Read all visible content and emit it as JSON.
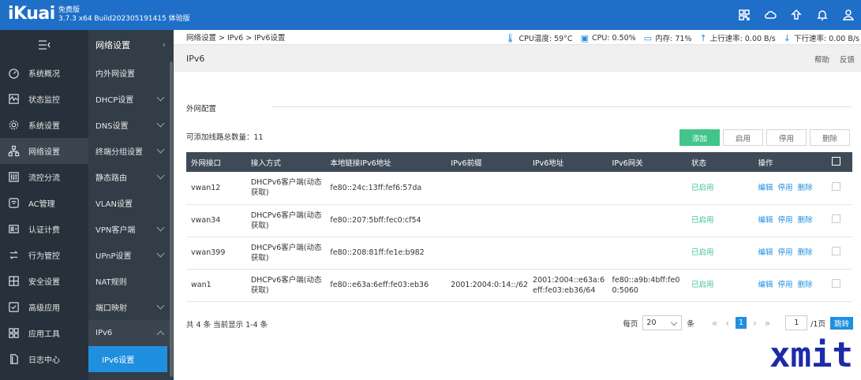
{
  "topbar": {
    "logo": "iKuai",
    "edition": "免费版",
    "version": "3.7.3 x64 Build202305191415 体验版",
    "icons": [
      "grid-icon",
      "cloud-icon",
      "upgrade-icon",
      "bell-icon",
      "user-icon"
    ]
  },
  "sidebar": {
    "items": [
      {
        "label": "系统概况",
        "icon": "dashboard-icon"
      },
      {
        "label": "状态监控",
        "icon": "monitor-icon"
      },
      {
        "label": "系统设置",
        "icon": "gear-icon"
      },
      {
        "label": "网络设置",
        "icon": "network-icon"
      },
      {
        "label": "流控分流",
        "icon": "flow-icon"
      },
      {
        "label": "AC管理",
        "icon": "ac-icon"
      },
      {
        "label": "认证计费",
        "icon": "auth-icon"
      },
      {
        "label": "行为管控",
        "icon": "behavior-icon"
      },
      {
        "label": "安全设置",
        "icon": "security-icon"
      },
      {
        "label": "高级应用",
        "icon": "advanced-icon"
      },
      {
        "label": "应用工具",
        "icon": "tools-icon"
      },
      {
        "label": "日志中心",
        "icon": "log-icon"
      }
    ]
  },
  "subnav": {
    "title": "网络设置",
    "items": [
      {
        "label": "内外网设置"
      },
      {
        "label": "DHCP设置"
      },
      {
        "label": "DNS设置"
      },
      {
        "label": "终端分组设置"
      },
      {
        "label": "静态路由"
      },
      {
        "label": "VLAN设置"
      },
      {
        "label": "VPN客户端"
      },
      {
        "label": "UPnP设置"
      },
      {
        "label": "NAT规则"
      },
      {
        "label": "端口映射"
      },
      {
        "label": "IPv6"
      },
      {
        "label": "IPv6设置"
      }
    ]
  },
  "breadcrumb": "网络设置 > IPv6 > IPv6设置",
  "stats": {
    "cpu_temp": "CPU温度: 59°C",
    "cpu": "CPU: 0.50%",
    "mem": "内存: 71%",
    "up": "上行速率: 0.00 B/s",
    "down": "下行速率: 0.00 B/s"
  },
  "page": {
    "title": "IPv6",
    "help": "帮助",
    "feedback": "反馈",
    "section": "外网配置",
    "count_label": "可添加线路总数量：11"
  },
  "buttons": {
    "add": "添加",
    "enable": "启用",
    "disable": "停用",
    "delete": "删除"
  },
  "table": {
    "headers": [
      "外网接口",
      "接入方式",
      "本地链接IPv6地址",
      "IPv6前缀",
      "IPv6地址",
      "IPv6网关",
      "状态",
      "操作"
    ],
    "rows": [
      {
        "iface": "vwan12",
        "mode": "DHCPv6客户端(动态获取)",
        "link": "fe80::24c:13ff:fef6:57da",
        "prefix": "",
        "addr": "",
        "gw": "",
        "status": "已启用"
      },
      {
        "iface": "vwan34",
        "mode": "DHCPv6客户端(动态获取)",
        "link": "fe80::207:5bff:fec0:cf54",
        "prefix": "",
        "addr": "",
        "gw": "",
        "status": "已启用"
      },
      {
        "iface": "vwan399",
        "mode": "DHCPv6客户端(动态获取)",
        "link": "fe80::208:81ff:fe1e:b982",
        "prefix": "",
        "addr": "",
        "gw": "",
        "status": "已启用"
      },
      {
        "iface": "wan1",
        "mode": "DHCPv6客户端(动态获取)",
        "link": "fe80::e63a:6eff:fe03:eb36",
        "prefix": "2001:2004:0:14::/62",
        "addr": "2001:2004::e63a:6eff:fe03:eb36/64",
        "gw": "fe80::a9b:4bff:fe00:5060",
        "status": "已启用"
      }
    ],
    "ops": {
      "edit": "编辑",
      "disable": "停用",
      "delete": "删除"
    }
  },
  "footer": {
    "summary": "共 4 条 当前显示 1-4 条",
    "per_page": "每页",
    "page_size": "20",
    "unit": "条",
    "current": "1",
    "page_input": "1",
    "total": "/1页",
    "jump": "跳转"
  },
  "watermark": "xmit"
}
